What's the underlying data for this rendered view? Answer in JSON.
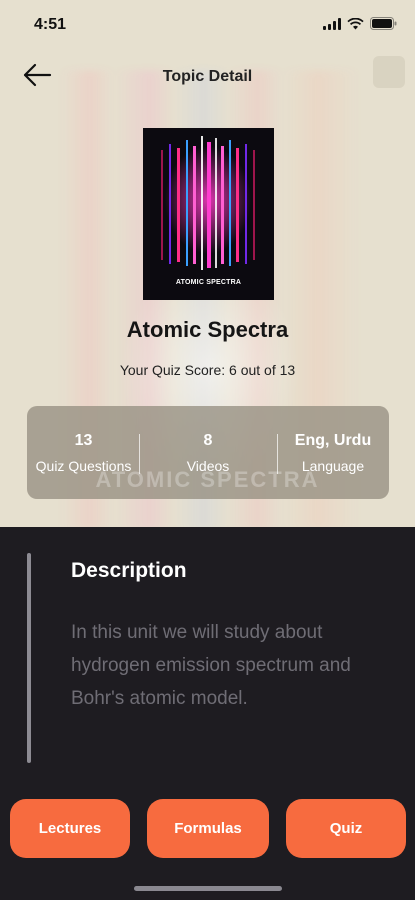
{
  "status_bar": {
    "time": "4:51"
  },
  "header": {
    "title": "Topic Detail"
  },
  "cover": {
    "caption": "ATOMIC SPECTRA"
  },
  "topic": {
    "name": "Atomic Spectra",
    "score": "Your Quiz Score: 6 out of 13"
  },
  "stats": [
    {
      "value": "13",
      "label": "Quiz Questions"
    },
    {
      "value": "8",
      "label": "Videos"
    },
    {
      "value": "Eng, Urdu",
      "label": "Language"
    }
  ],
  "watermark": "ATOMIC SPECTRA",
  "description": {
    "title": "Description",
    "text": "In this unit we will study about hydrogen emission spectrum and Bohr's atomic model."
  },
  "actions": {
    "lectures": "Lectures",
    "formulas": "Formulas",
    "quiz": "Quiz"
  },
  "colors": {
    "accent": "#f76b3f",
    "top_background": "#e6e0cf",
    "bottom_background": "#1e1c21"
  }
}
